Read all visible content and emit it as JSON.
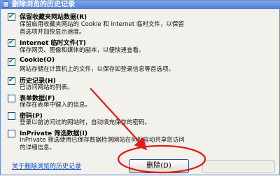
{
  "window": {
    "title": "删除浏览的历史记录"
  },
  "items": [
    {
      "label": "保留收藏夹网站数据(R)",
      "desc": [
        "保留启用收藏夹网站的 Cookie 和 Internet 临时文件，以保留",
        "首选项并加快显示速度。"
      ],
      "checked": true
    },
    {
      "label": "Internet 临时文件(T)",
      "desc": [
        "保存网页、图像和媒体的副本，以便快速查看。"
      ],
      "checked": true
    },
    {
      "label": "Cookie(O)",
      "desc": [
        "网站存储在计算机上的文件，以保存如登录信息等首选项。"
      ],
      "checked": true
    },
    {
      "label": "历史记录(H)",
      "desc": [
        "已访问网站的列表。"
      ],
      "checked": true
    },
    {
      "label": "表单数据(F)",
      "desc": [
        "保存在表单中键入的信息。"
      ],
      "checked": false
    },
    {
      "label": "密码(P)",
      "desc": [
        "登录以前访问过的网站时，自动填充保存的密码。"
      ],
      "checked": false
    },
    {
      "label": "InPrivate 筛选数据(I)",
      "desc": [
        "InPrivate 筛选使用已保存数据检测网站在何处自动共享您访问",
        "的详细信息。"
      ],
      "checked": false
    }
  ],
  "footer": {
    "link": "关于删除浏览的历史记录",
    "delete_button": "删除(D)"
  },
  "colors": {
    "annotation": "#e11b1b",
    "title_bar": "#4f7fd6"
  }
}
